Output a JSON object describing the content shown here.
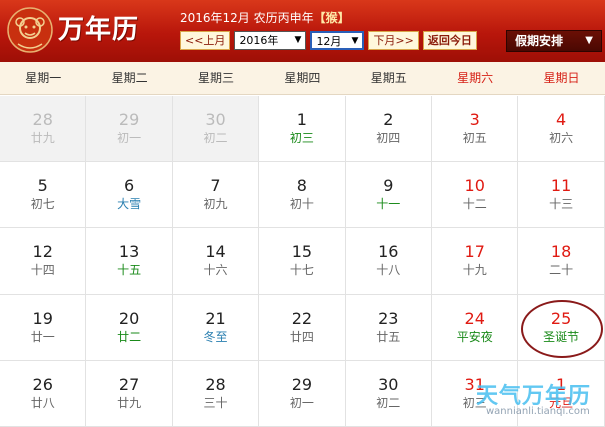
{
  "header": {
    "app_title": "万年历",
    "date_prefix": "2016年12月 农历丙申年",
    "zodiac": "【猴】",
    "prev_month_label": "<<上月",
    "year_value": "2016年",
    "month_value": "12月",
    "next_month_label": "下月>>",
    "today_label": "返回今日",
    "holiday_label": "假期安排"
  },
  "weekdays": [
    {
      "label": "星期一",
      "weekend": false
    },
    {
      "label": "星期二",
      "weekend": false
    },
    {
      "label": "星期三",
      "weekend": false
    },
    {
      "label": "星期四",
      "weekend": false
    },
    {
      "label": "星期五",
      "weekend": false
    },
    {
      "label": "星期六",
      "weekend": true
    },
    {
      "label": "星期日",
      "weekend": true
    }
  ],
  "weeks": [
    [
      {
        "day": "28",
        "lunar": "廿九",
        "other": true
      },
      {
        "day": "29",
        "lunar": "初一",
        "other": true
      },
      {
        "day": "30",
        "lunar": "初二",
        "other": true
      },
      {
        "day": "1",
        "lunar": "初三",
        "lunar_style": "term"
      },
      {
        "day": "2",
        "lunar": "初四"
      },
      {
        "day": "3",
        "lunar": "初五",
        "weekend": true
      },
      {
        "day": "4",
        "lunar": "初六",
        "weekend": true
      }
    ],
    [
      {
        "day": "5",
        "lunar": "初七"
      },
      {
        "day": "6",
        "lunar": "大雪",
        "lunar_style": "solar"
      },
      {
        "day": "7",
        "lunar": "初九"
      },
      {
        "day": "8",
        "lunar": "初十"
      },
      {
        "day": "9",
        "lunar": "十一",
        "lunar_style": "term"
      },
      {
        "day": "10",
        "lunar": "十二",
        "weekend": true
      },
      {
        "day": "11",
        "lunar": "十三",
        "weekend": true
      }
    ],
    [
      {
        "day": "12",
        "lunar": "十四"
      },
      {
        "day": "13",
        "lunar": "十五",
        "lunar_style": "term"
      },
      {
        "day": "14",
        "lunar": "十六"
      },
      {
        "day": "15",
        "lunar": "十七"
      },
      {
        "day": "16",
        "lunar": "十八"
      },
      {
        "day": "17",
        "lunar": "十九",
        "weekend": true
      },
      {
        "day": "18",
        "lunar": "二十",
        "weekend": true
      }
    ],
    [
      {
        "day": "19",
        "lunar": "廿一"
      },
      {
        "day": "20",
        "lunar": "廿二",
        "lunar_style": "term"
      },
      {
        "day": "21",
        "lunar": "冬至",
        "lunar_style": "solar"
      },
      {
        "day": "22",
        "lunar": "廿四"
      },
      {
        "day": "23",
        "lunar": "廿五"
      },
      {
        "day": "24",
        "lunar": "平安夜",
        "weekend": true,
        "lunar_style": "festival"
      },
      {
        "day": "25",
        "lunar": "圣诞节",
        "weekend": true,
        "lunar_style": "festival",
        "circled": true
      }
    ],
    [
      {
        "day": "26",
        "lunar": "廿八"
      },
      {
        "day": "27",
        "lunar": "廿九"
      },
      {
        "day": "28",
        "lunar": "三十"
      },
      {
        "day": "29",
        "lunar": "初一"
      },
      {
        "day": "30",
        "lunar": "初二"
      },
      {
        "day": "31",
        "lunar": "初三",
        "weekend": true
      },
      {
        "day": "1",
        "lunar": "元旦",
        "weekend": true,
        "lunar_style": "fest-red"
      }
    ]
  ],
  "watermark": {
    "text": "天气万年历",
    "url": "wannianli.tianqi.com"
  },
  "colors": {
    "header_red": "#c0200f",
    "weekend_red": "#e01a12",
    "term_green": "#1a8a1a",
    "solar_blue": "#2a7fb0"
  }
}
